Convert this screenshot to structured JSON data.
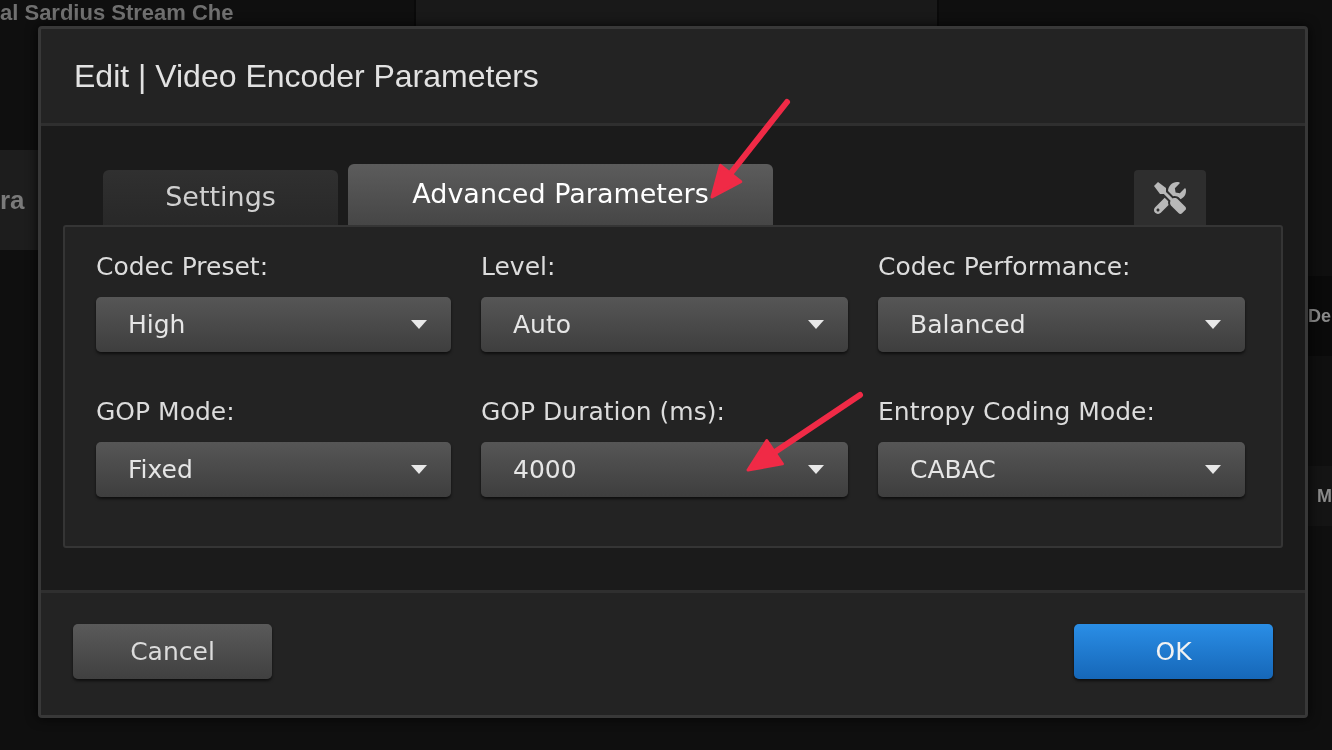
{
  "background": {
    "title": "al Sardius Stream Che",
    "left_fragment": "ra",
    "right_fragments": [
      "De",
      "M"
    ]
  },
  "dialog": {
    "title": "Edit | Video Encoder Parameters",
    "tabs": [
      {
        "label": "Settings",
        "selected": false
      },
      {
        "label": "Advanced Parameters",
        "selected": true
      }
    ],
    "fields": [
      {
        "label": "Codec Preset:",
        "value": "High"
      },
      {
        "label": "Level:",
        "value": "Auto"
      },
      {
        "label": "Codec Performance:",
        "value": "Balanced"
      },
      {
        "label": "GOP Mode:",
        "value": "Fixed"
      },
      {
        "label": "GOP Duration (ms):",
        "value": "4000"
      },
      {
        "label": "Entropy Coding Mode:",
        "value": "CABAC"
      }
    ],
    "buttons": [
      {
        "label": "Cancel",
        "kind": "secondary"
      },
      {
        "label": "OK",
        "kind": "primary"
      }
    ]
  }
}
